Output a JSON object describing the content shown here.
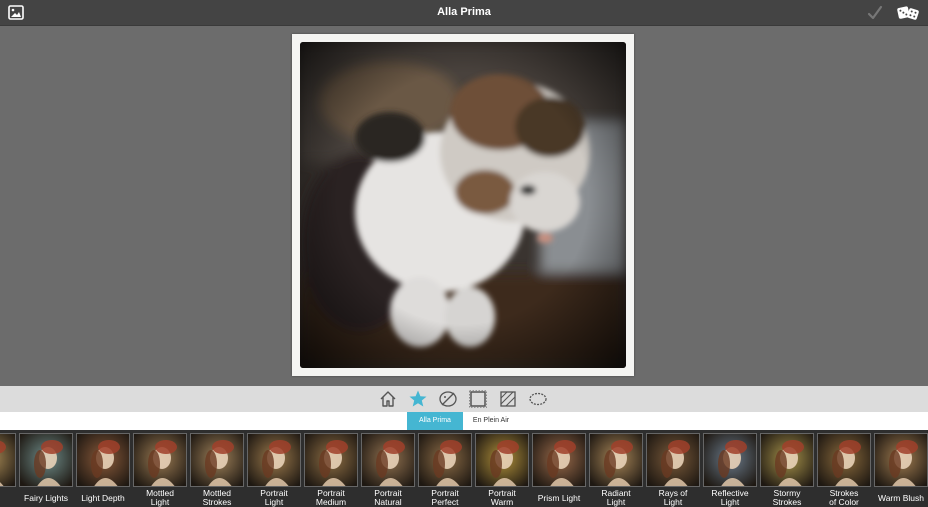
{
  "header": {
    "title": "Alla Prima",
    "gallery_icon": "image-gallery-icon",
    "confirm_icon": "checkmark-icon",
    "random_icon": "dice-icon"
  },
  "toolbar": {
    "tools": [
      {
        "icon": "home-icon"
      },
      {
        "icon": "star-icon",
        "active": true
      },
      {
        "icon": "palette-brush-icon"
      },
      {
        "icon": "frame-border-icon"
      },
      {
        "icon": "canvas-texture-icon"
      },
      {
        "icon": "vignette-icon"
      }
    ],
    "active_color": "#45b6d2"
  },
  "tabs": [
    {
      "label": "Alla Prima",
      "active": true
    },
    {
      "label": "En Plein Air",
      "active": false
    }
  ],
  "presets": [
    {
      "label": "e",
      "tone": "#a88a55"
    },
    {
      "label": "Fairy Lights",
      "tone": "#6f8d8a"
    },
    {
      "label": "Light Depth",
      "tone": "#8a5a3a"
    },
    {
      "label": "Mottled\nLight",
      "tone": "#9a7a52"
    },
    {
      "label": "Mottled\nStrokes",
      "tone": "#a0825a"
    },
    {
      "label": "Portrait\nLight",
      "tone": "#9c7a4c"
    },
    {
      "label": "Portrait\nMedium",
      "tone": "#8e6e44"
    },
    {
      "label": "Portrait\nNatural",
      "tone": "#927250"
    },
    {
      "label": "Portrait\nPerfect",
      "tone": "#8c6c46"
    },
    {
      "label": "Portrait\nWarm",
      "tone": "#b0903a"
    },
    {
      "label": "Prism Light",
      "tone": "#9a6a4a"
    },
    {
      "label": "Radiant\nLight",
      "tone": "#a88658"
    },
    {
      "label": "Rays of\nLight",
      "tone": "#7a5a3a"
    },
    {
      "label": "Reflective\nLight",
      "tone": "#6a7a8a"
    },
    {
      "label": "Stormy\nStrokes",
      "tone": "#a6924a"
    },
    {
      "label": "Strokes\nof Color",
      "tone": "#8a6a3c"
    },
    {
      "label": "Warm Blush",
      "tone": "#a07c50"
    }
  ]
}
